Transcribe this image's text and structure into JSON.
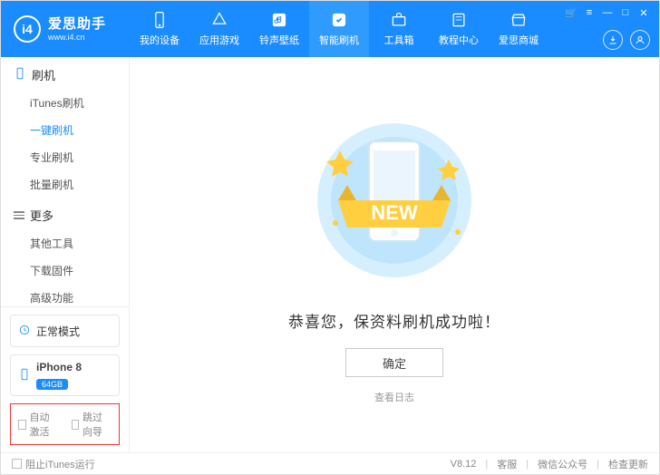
{
  "brand": {
    "name": "爱思助手",
    "url": "www.i4.cn",
    "logo_letters": "i4"
  },
  "nav": {
    "items": [
      {
        "label": "我的设备",
        "icon": "phone"
      },
      {
        "label": "应用游戏",
        "icon": "apps"
      },
      {
        "label": "铃声壁纸",
        "icon": "music"
      },
      {
        "label": "智能刷机",
        "icon": "flash",
        "active": true
      },
      {
        "label": "工具箱",
        "icon": "toolbox"
      },
      {
        "label": "教程中心",
        "icon": "book"
      },
      {
        "label": "爱思商城",
        "icon": "store"
      }
    ]
  },
  "window_controls": {
    "cart": "⁝≡",
    "menu": "≡",
    "min": "—",
    "max": "□",
    "close": "✕"
  },
  "header_circles": {
    "download": "download",
    "user": "user"
  },
  "sidebar": {
    "groups": [
      {
        "title": "刷机",
        "icon": "phone",
        "items": [
          {
            "label": "iTunes刷机"
          },
          {
            "label": "一键刷机",
            "active": true
          },
          {
            "label": "专业刷机"
          },
          {
            "label": "批量刷机"
          }
        ]
      },
      {
        "title": "更多",
        "icon": "hamburger",
        "items": [
          {
            "label": "其他工具"
          },
          {
            "label": "下载固件"
          },
          {
            "label": "高级功能"
          }
        ]
      }
    ],
    "mode": {
      "label": "正常模式",
      "icon": "shield"
    },
    "device": {
      "name": "iPhone 8",
      "badge": "64GB"
    },
    "redbox": {
      "auto_activate": "自动激活",
      "skip_guide": "跳过向导"
    }
  },
  "main": {
    "ribbon_text": "NEW",
    "success_text": "恭喜您，保资料刷机成功啦！",
    "ok_button": "确定",
    "log_link": "查看日志"
  },
  "footer": {
    "block_itunes": "阻止iTunes运行",
    "version": "V8.12",
    "support": "客服",
    "wechat": "微信公众号",
    "update": "检查更新"
  }
}
